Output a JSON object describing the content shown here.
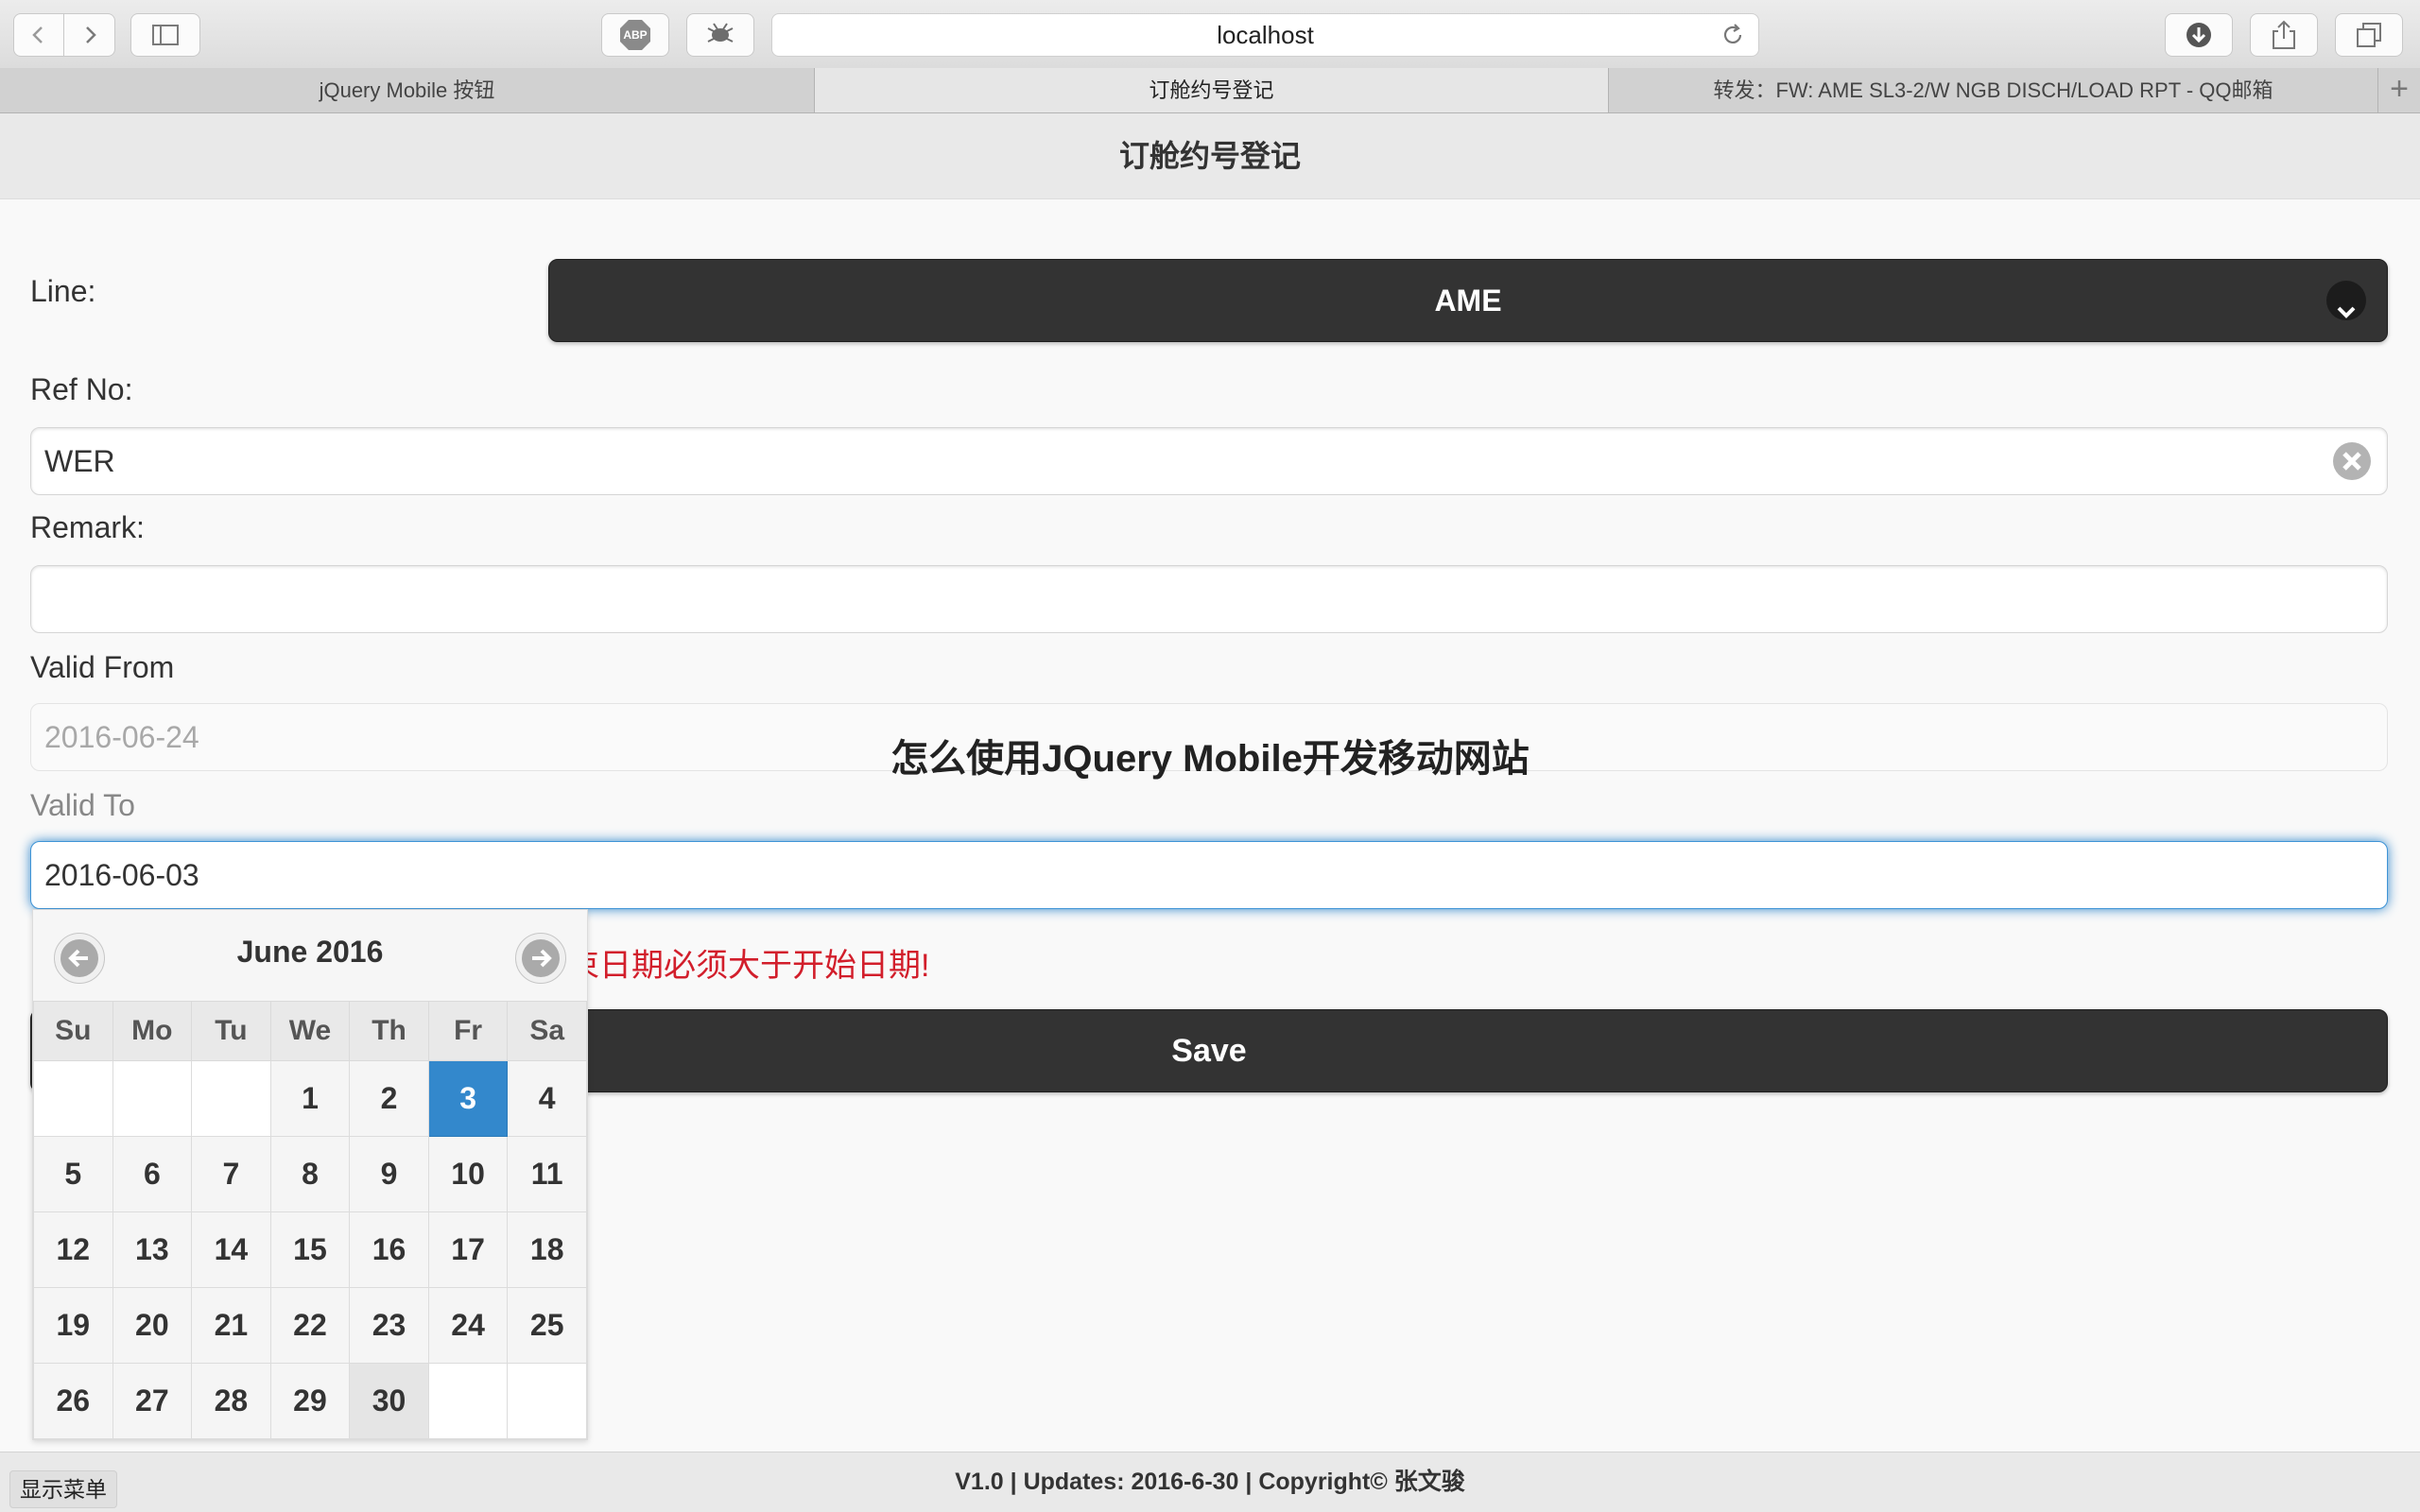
{
  "browser": {
    "url": "localhost",
    "tabs": [
      {
        "label": "jQuery Mobile 按钮"
      },
      {
        "label": "订舱约号登记"
      },
      {
        "label": "转发：FW: AME SL3-2/W NGB DISCH/LOAD RPT - QQ邮箱"
      }
    ],
    "adblock_label": "ABP"
  },
  "page": {
    "title": "订舱约号登记",
    "watermark": "怎么使用JQuery Mobile开发移动网站"
  },
  "form": {
    "line_label": "Line:",
    "line_value": "AME",
    "ref_label": "Ref No:",
    "ref_value": "WER",
    "remark_label": "Remark:",
    "remark_value": "",
    "valid_from_label": "Valid From",
    "valid_from_value": "2016-06-24",
    "valid_to_label": "Valid To",
    "valid_to_value": "2016-06-03",
    "error_text": "束日期必须大于开始日期!",
    "save_label": "Save"
  },
  "datepicker": {
    "title": "June 2016",
    "weekdays": [
      "Su",
      "Mo",
      "Tu",
      "We",
      "Th",
      "Fr",
      "Sa"
    ],
    "weeks": [
      [
        "",
        "",
        "",
        "1",
        "2",
        "3",
        "4"
      ],
      [
        "5",
        "6",
        "7",
        "8",
        "9",
        "10",
        "11"
      ],
      [
        "12",
        "13",
        "14",
        "15",
        "16",
        "17",
        "18"
      ],
      [
        "19",
        "20",
        "21",
        "22",
        "23",
        "24",
        "25"
      ],
      [
        "26",
        "27",
        "28",
        "29",
        "30",
        "",
        ""
      ]
    ],
    "selected_day": "3",
    "today_day": "30"
  },
  "footer": {
    "text": "V1.0 | Updates: 2016-6-30 | Copyright© 张文骏",
    "menu_label": "显示菜单"
  },
  "colors": {
    "accent": "#3388cc",
    "error": "#d21e2b",
    "button_dark": "#333333"
  }
}
